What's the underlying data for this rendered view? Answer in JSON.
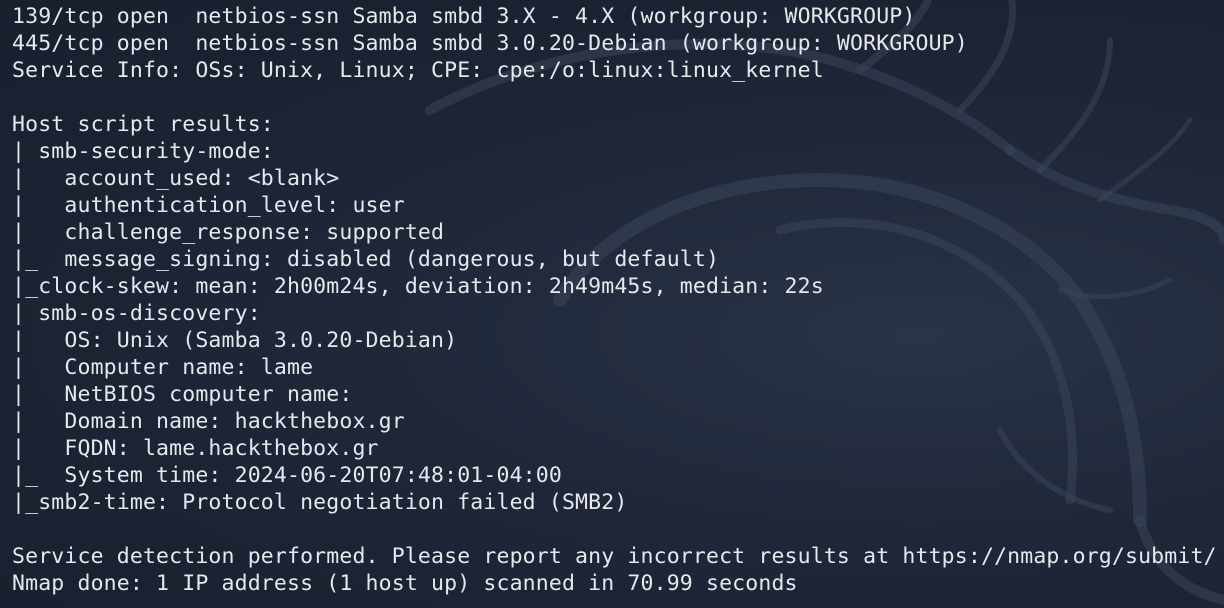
{
  "terminal": {
    "lines": [
      "139/tcp open  netbios-ssn Samba smbd 3.X - 4.X (workgroup: WORKGROUP)",
      "445/tcp open  netbios-ssn Samba smbd 3.0.20-Debian (workgroup: WORKGROUP)",
      "Service Info: OSs: Unix, Linux; CPE: cpe:/o:linux:linux_kernel",
      "",
      "Host script results:",
      "| smb-security-mode:",
      "|   account_used: <blank>",
      "|   authentication_level: user",
      "|   challenge_response: supported",
      "|_  message_signing: disabled (dangerous, but default)",
      "|_clock-skew: mean: 2h00m24s, deviation: 2h49m45s, median: 22s",
      "| smb-os-discovery:",
      "|   OS: Unix (Samba 3.0.20-Debian)",
      "|   Computer name: lame",
      "|   NetBIOS computer name:",
      "|   Domain name: hackthebox.gr",
      "|   FQDN: lame.hackthebox.gr",
      "|_  System time: 2024-06-20T07:48:01-04:00",
      "|_smb2-time: Protocol negotiation failed (SMB2)",
      "",
      "Service detection performed. Please report any incorrect results at https://nmap.org/submit/ .",
      "Nmap done: 1 IP address (1 host up) scanned in 70.99 seconds"
    ]
  },
  "colors": {
    "background": "#1b2333",
    "text": "#e6e8ec"
  },
  "icons": {
    "watermark": "kali-dragon-icon"
  }
}
